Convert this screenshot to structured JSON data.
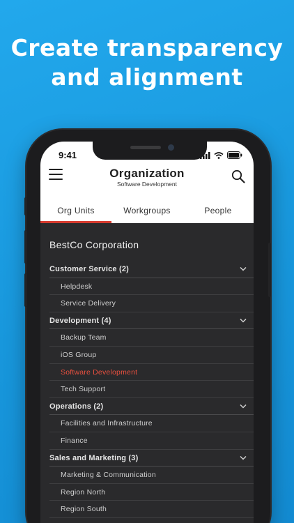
{
  "promo": {
    "headline_line1": "Create transparency",
    "headline_line2": "and alignment"
  },
  "status_bar": {
    "time": "9:41"
  },
  "header": {
    "title": "Organization",
    "subtitle": "Software Development",
    "menu_icon": "hamburger-menu-icon",
    "search_icon": "search-icon"
  },
  "tabs": [
    {
      "label": "Org Units",
      "active": true
    },
    {
      "label": "Workgroups",
      "active": false
    },
    {
      "label": "People",
      "active": false
    }
  ],
  "company": "BestCo Corporation",
  "groups": [
    {
      "label": "Customer Service (2)",
      "children": [
        "Helpdesk",
        "Service Delivery"
      ]
    },
    {
      "label": "Development (4)",
      "children": [
        "Backup Team",
        "iOS Group",
        "Software Development",
        "Tech Support"
      ]
    },
    {
      "label": "Operations (2)",
      "children": [
        "Facilities and Infrastructure",
        "Finance"
      ]
    },
    {
      "label": "Sales and Marketing (3)",
      "children": [
        "Marketing & Communication",
        "Region North",
        "Region South"
      ]
    }
  ],
  "selected_item": "Software Development",
  "colors": {
    "background": "#1a9fe3",
    "accent": "#d63b2f",
    "selected_text": "#e8503f",
    "list_background": "#2a2a2c"
  }
}
